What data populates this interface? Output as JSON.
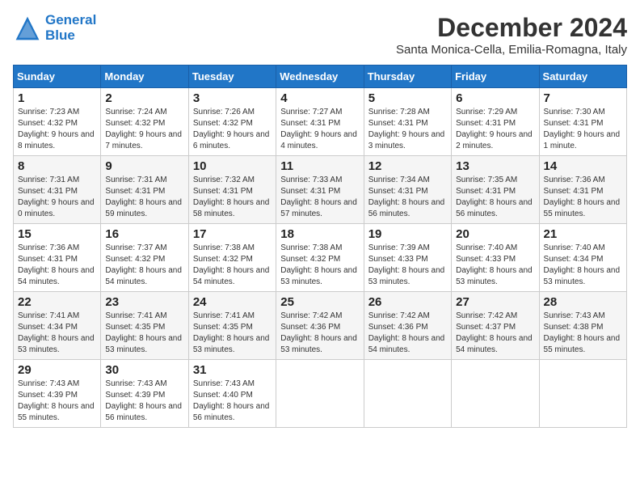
{
  "header": {
    "logo_general": "General",
    "logo_blue": "Blue",
    "month": "December 2024",
    "location": "Santa Monica-Cella, Emilia-Romagna, Italy"
  },
  "days_of_week": [
    "Sunday",
    "Monday",
    "Tuesday",
    "Wednesday",
    "Thursday",
    "Friday",
    "Saturday"
  ],
  "weeks": [
    [
      {
        "day": 1,
        "sunrise": "7:23 AM",
        "sunset": "4:32 PM",
        "daylight": "9 hours and 8 minutes."
      },
      {
        "day": 2,
        "sunrise": "7:24 AM",
        "sunset": "4:32 PM",
        "daylight": "9 hours and 7 minutes."
      },
      {
        "day": 3,
        "sunrise": "7:26 AM",
        "sunset": "4:32 PM",
        "daylight": "9 hours and 6 minutes."
      },
      {
        "day": 4,
        "sunrise": "7:27 AM",
        "sunset": "4:31 PM",
        "daylight": "9 hours and 4 minutes."
      },
      {
        "day": 5,
        "sunrise": "7:28 AM",
        "sunset": "4:31 PM",
        "daylight": "9 hours and 3 minutes."
      },
      {
        "day": 6,
        "sunrise": "7:29 AM",
        "sunset": "4:31 PM",
        "daylight": "9 hours and 2 minutes."
      },
      {
        "day": 7,
        "sunrise": "7:30 AM",
        "sunset": "4:31 PM",
        "daylight": "9 hours and 1 minute."
      }
    ],
    [
      {
        "day": 8,
        "sunrise": "7:31 AM",
        "sunset": "4:31 PM",
        "daylight": "9 hours and 0 minutes."
      },
      {
        "day": 9,
        "sunrise": "7:31 AM",
        "sunset": "4:31 PM",
        "daylight": "8 hours and 59 minutes."
      },
      {
        "day": 10,
        "sunrise": "7:32 AM",
        "sunset": "4:31 PM",
        "daylight": "8 hours and 58 minutes."
      },
      {
        "day": 11,
        "sunrise": "7:33 AM",
        "sunset": "4:31 PM",
        "daylight": "8 hours and 57 minutes."
      },
      {
        "day": 12,
        "sunrise": "7:34 AM",
        "sunset": "4:31 PM",
        "daylight": "8 hours and 56 minutes."
      },
      {
        "day": 13,
        "sunrise": "7:35 AM",
        "sunset": "4:31 PM",
        "daylight": "8 hours and 56 minutes."
      },
      {
        "day": 14,
        "sunrise": "7:36 AM",
        "sunset": "4:31 PM",
        "daylight": "8 hours and 55 minutes."
      }
    ],
    [
      {
        "day": 15,
        "sunrise": "7:36 AM",
        "sunset": "4:31 PM",
        "daylight": "8 hours and 54 minutes."
      },
      {
        "day": 16,
        "sunrise": "7:37 AM",
        "sunset": "4:32 PM",
        "daylight": "8 hours and 54 minutes."
      },
      {
        "day": 17,
        "sunrise": "7:38 AM",
        "sunset": "4:32 PM",
        "daylight": "8 hours and 54 minutes."
      },
      {
        "day": 18,
        "sunrise": "7:38 AM",
        "sunset": "4:32 PM",
        "daylight": "8 hours and 53 minutes."
      },
      {
        "day": 19,
        "sunrise": "7:39 AM",
        "sunset": "4:33 PM",
        "daylight": "8 hours and 53 minutes."
      },
      {
        "day": 20,
        "sunrise": "7:40 AM",
        "sunset": "4:33 PM",
        "daylight": "8 hours and 53 minutes."
      },
      {
        "day": 21,
        "sunrise": "7:40 AM",
        "sunset": "4:34 PM",
        "daylight": "8 hours and 53 minutes."
      }
    ],
    [
      {
        "day": 22,
        "sunrise": "7:41 AM",
        "sunset": "4:34 PM",
        "daylight": "8 hours and 53 minutes."
      },
      {
        "day": 23,
        "sunrise": "7:41 AM",
        "sunset": "4:35 PM",
        "daylight": "8 hours and 53 minutes."
      },
      {
        "day": 24,
        "sunrise": "7:41 AM",
        "sunset": "4:35 PM",
        "daylight": "8 hours and 53 minutes."
      },
      {
        "day": 25,
        "sunrise": "7:42 AM",
        "sunset": "4:36 PM",
        "daylight": "8 hours and 53 minutes."
      },
      {
        "day": 26,
        "sunrise": "7:42 AM",
        "sunset": "4:36 PM",
        "daylight": "8 hours and 54 minutes."
      },
      {
        "day": 27,
        "sunrise": "7:42 AM",
        "sunset": "4:37 PM",
        "daylight": "8 hours and 54 minutes."
      },
      {
        "day": 28,
        "sunrise": "7:43 AM",
        "sunset": "4:38 PM",
        "daylight": "8 hours and 55 minutes."
      }
    ],
    [
      {
        "day": 29,
        "sunrise": "7:43 AM",
        "sunset": "4:39 PM",
        "daylight": "8 hours and 55 minutes."
      },
      {
        "day": 30,
        "sunrise": "7:43 AM",
        "sunset": "4:39 PM",
        "daylight": "8 hours and 56 minutes."
      },
      {
        "day": 31,
        "sunrise": "7:43 AM",
        "sunset": "4:40 PM",
        "daylight": "8 hours and 56 minutes."
      },
      null,
      null,
      null,
      null
    ]
  ]
}
